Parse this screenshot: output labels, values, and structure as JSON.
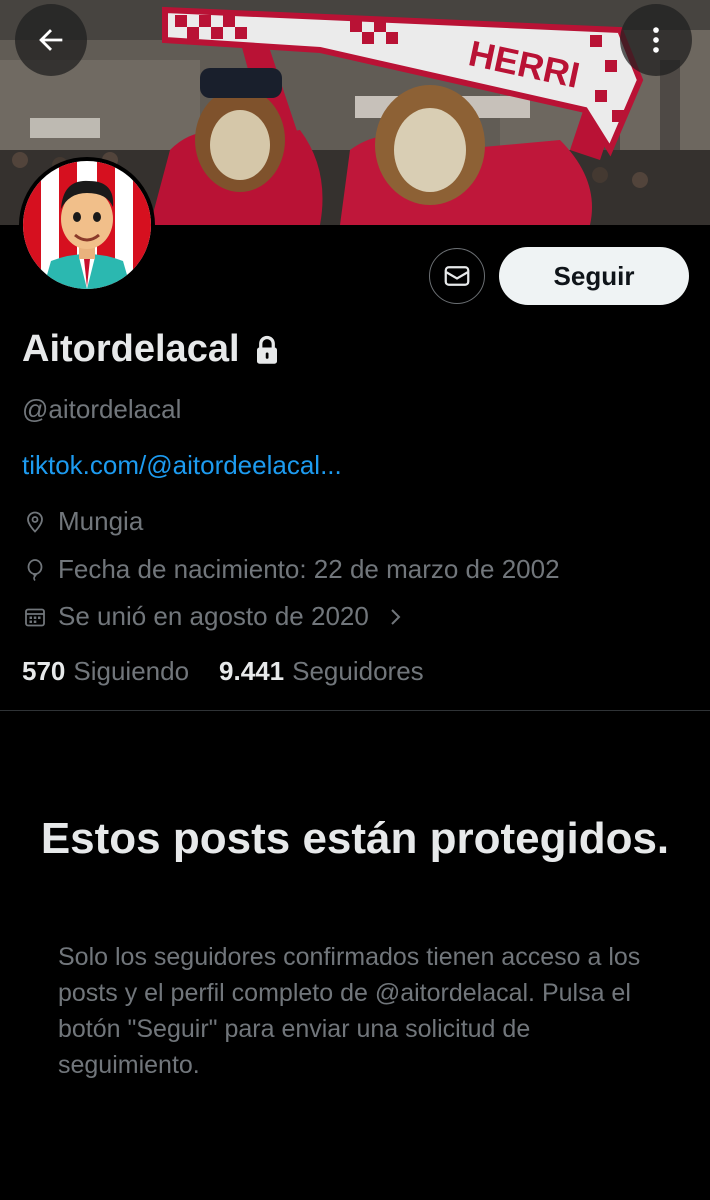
{
  "header": {
    "back_icon": "arrow-left-icon",
    "more_icon": "more-vertical-icon",
    "banner_scarf_text": "HERRI"
  },
  "profile": {
    "display_name": "Aitordelacal",
    "handle": "@aitordelacal",
    "link": "tiktok.com/@aitordeelacal...",
    "location": "Mungia",
    "birth": "Fecha de nacimiento: 22 de marzo de 2002",
    "joined": "Se unió en agosto de 2020"
  },
  "actions": {
    "message_icon": "envelope-icon",
    "follow_label": "Seguir"
  },
  "stats": {
    "following_count": "570",
    "following_label": "Siguiendo",
    "followers_count": "9.441",
    "followers_label": "Seguidores"
  },
  "protected": {
    "title": "Estos posts están protegidos.",
    "description": "Solo los seguidores confirmados tienen acceso a los posts y el perfil completo de @aitordelacal. Pulsa el botón \"Seguir\" para enviar una solicitud de seguimiento."
  },
  "colors": {
    "background": "#000000",
    "link": "#1d9bf0",
    "muted": "#71767b",
    "text": "#e7e9ea",
    "follow_button_bg": "#eff3f4"
  }
}
